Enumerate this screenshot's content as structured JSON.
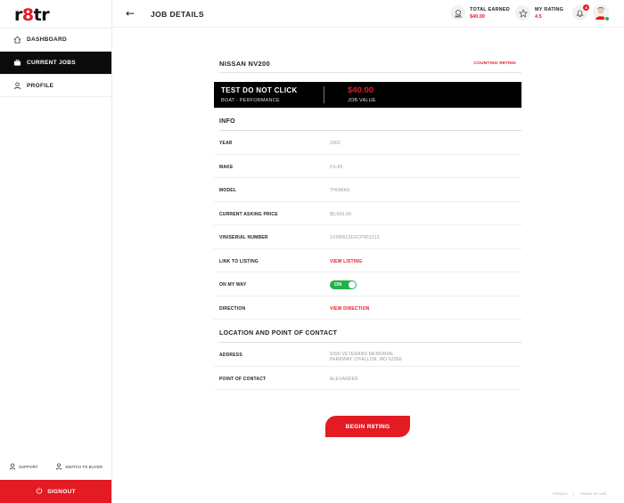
{
  "app": {
    "logo_prefix": "r",
    "logo_eight": "8",
    "logo_suffix": "tr"
  },
  "sidebar": {
    "items": [
      {
        "label": "DASHBOARD",
        "icon": "home-icon"
      },
      {
        "label": "CURRENT JOBS",
        "icon": "briefcase-icon",
        "active": true
      },
      {
        "label": "PROFILE",
        "icon": "user-icon"
      }
    ],
    "support_label": "SUPPORT",
    "switch_label": "SWITCH TO BUYER",
    "signout_label": "SIGNOUT"
  },
  "header": {
    "title": "JOB DETAILS",
    "total_earned_label": "TOTAL EARNED",
    "total_earned_value": "$40.00",
    "rating_label": "MY RATING",
    "rating_value": "4.5",
    "notifications_count": "4"
  },
  "job": {
    "vehicle": "NISSAN NV200",
    "status": "COUNTING R8TING",
    "title": "TEST DO NOT CLICK",
    "subtitle": "BOAT - PERFORMANCE",
    "value": "$40.00",
    "value_label": "JOB VALUE"
  },
  "info": {
    "heading": "INFO",
    "rows": [
      {
        "label": "YEAR",
        "value": "2002"
      },
      {
        "label": "MAKE",
        "value": "FS-65"
      },
      {
        "label": "MODEL",
        "value": "THOMAS"
      },
      {
        "label": "CURRENT ASKING PRICE",
        "value": "$5,000.00"
      },
      {
        "label": "VIN/SERIAL NUMBER",
        "value": "1VXBR12EXCP901213"
      },
      {
        "label": "LINK TO LISTING",
        "value": "VIEW LISTING"
      },
      {
        "label": "ON MY WAY",
        "value": "ON"
      },
      {
        "label": "DIRECTION",
        "value": "VIEW DIRECTION"
      }
    ]
  },
  "location": {
    "heading": "LOCATION AND POINT OF CONTACT",
    "address_label": "ADDRESS",
    "address_line1": "9390 VETERANS MEMORIAL",
    "address_line2": "PARKWAY O'FALLON, MO 63366",
    "contact_label": "POINT OF CONTACT",
    "contact_value": "ALEXANDER"
  },
  "actions": {
    "begin_label": "BEGIN R8TING"
  },
  "footer": {
    "privacy": "PRIVACY",
    "sep": "|",
    "terms": "TERMS OF USE"
  },
  "colors": {
    "accent": "#e31b23",
    "success": "#22b14c",
    "dark": "#0b0b0b"
  }
}
